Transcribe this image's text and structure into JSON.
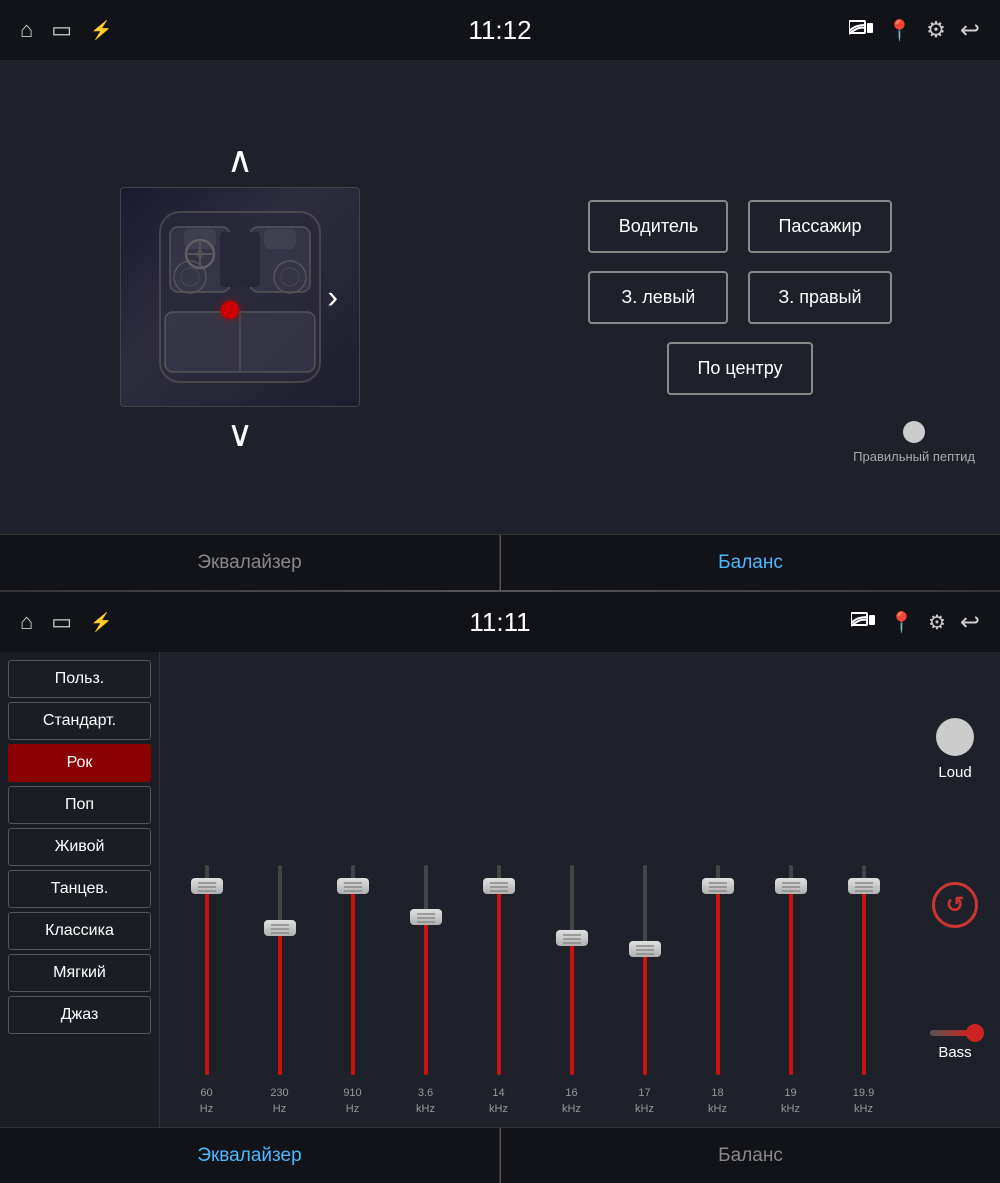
{
  "top": {
    "statusBar": {
      "time": "11:12",
      "icons": {
        "home": "⌂",
        "screen": "▭",
        "usb": "⚡",
        "cast": "📡",
        "location": "📍",
        "bluetooth": "⚙",
        "back": "↩"
      }
    },
    "arrows": {
      "up": "∧",
      "down": "∨",
      "left": "‹",
      "right": "›"
    },
    "buttons": [
      {
        "id": "driver",
        "label": "Водитель"
      },
      {
        "id": "passenger",
        "label": "Пассажир"
      },
      {
        "id": "rear-left",
        "label": "З. левый"
      },
      {
        "id": "rear-right",
        "label": "З. правый"
      },
      {
        "id": "center",
        "label": "По центру"
      }
    ],
    "infoText": "Правильный пептид",
    "tabs": [
      {
        "id": "equalizer",
        "label": "Эквалайзер",
        "active": false
      },
      {
        "id": "balance",
        "label": "Баланс",
        "active": true
      }
    ]
  },
  "bottom": {
    "statusBar": {
      "time": "11:11"
    },
    "presets": [
      {
        "id": "user",
        "label": "Польз.",
        "active": false
      },
      {
        "id": "standard",
        "label": "Стандарт.",
        "active": false
      },
      {
        "id": "rock",
        "label": "Рок",
        "active": true
      },
      {
        "id": "pop",
        "label": "Поп",
        "active": false
      },
      {
        "id": "live",
        "label": "Живой",
        "active": false
      },
      {
        "id": "dance",
        "label": "Танцев.",
        "active": false
      },
      {
        "id": "classic",
        "label": "Классика",
        "active": false
      },
      {
        "id": "soft",
        "label": "Мягкий",
        "active": false
      },
      {
        "id": "jazz",
        "label": "Джаз",
        "active": false
      }
    ],
    "bands": [
      {
        "freq": "60",
        "unit": "Hz",
        "value": 90
      },
      {
        "freq": "230",
        "unit": "Hz",
        "value": 70
      },
      {
        "freq": "910",
        "unit": "Hz",
        "value": 90
      },
      {
        "freq": "3.6",
        "unit": "kHz",
        "value": 75
      },
      {
        "freq": "14",
        "unit": "kHz",
        "value": 90
      },
      {
        "freq": "16",
        "unit": "kHz",
        "value": 65
      },
      {
        "freq": "17",
        "unit": "kHz",
        "value": 60
      },
      {
        "freq": "18",
        "unit": "kHz",
        "value": 90
      },
      {
        "freq": "19",
        "unit": "kHz",
        "value": 90
      },
      {
        "freq": "19.9",
        "unit": "kHz",
        "value": 90
      }
    ],
    "controls": {
      "loud": "Loud",
      "reset": "↺",
      "bass": "Bass"
    },
    "tabs": [
      {
        "id": "equalizer",
        "label": "Эквалайзер",
        "active": true
      },
      {
        "id": "balance",
        "label": "Баланс",
        "active": false
      }
    ]
  }
}
